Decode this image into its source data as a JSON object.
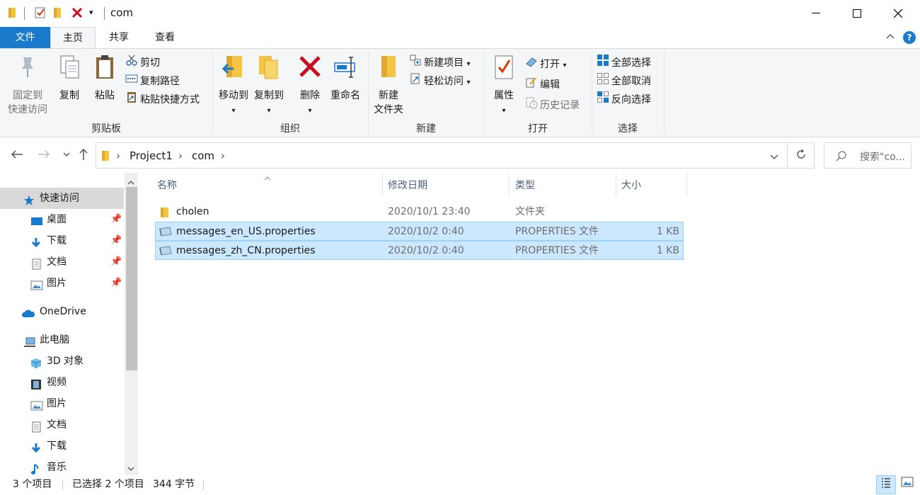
{
  "window": {
    "title": "com",
    "qat_dropdown": "▾",
    "minimize": "—",
    "maximize": "☐",
    "close": "✕",
    "help": "?",
    "collapse": "^"
  },
  "ribbon_tabs": [
    "文件",
    "主页",
    "共享",
    "查看"
  ],
  "ribbon": {
    "clipboard": {
      "label": "剪贴板",
      "pin_line1": "固定到",
      "pin_line2": "快速访问",
      "copy": "复制",
      "paste": "粘贴",
      "cut": "剪切",
      "copy_path": "复制路径",
      "paste_shortcut": "粘贴快捷方式"
    },
    "organize": {
      "label": "组织",
      "move_to": "移动到",
      "copy_to": "复制到",
      "delete": "删除",
      "rename": "重命名"
    },
    "new": {
      "label": "新建",
      "new_folder_line1": "新建",
      "new_folder_line2": "文件夹",
      "new_item": "新建项目",
      "easy_access": "轻松访问"
    },
    "open": {
      "label": "打开",
      "properties": "属性",
      "open": "打开",
      "edit": "编辑",
      "history": "历史记录"
    },
    "select": {
      "label": "选择",
      "select_all": "全部选择",
      "select_none": "全部取消",
      "invert": "反向选择"
    }
  },
  "address": {
    "crumbs": [
      "Project1",
      "com"
    ],
    "search_placeholder": "搜索\"co..."
  },
  "nav": {
    "quick_access": "快速访问",
    "desktop": "桌面",
    "downloads": "下载",
    "documents": "文档",
    "pictures": "图片",
    "onedrive": "OneDrive",
    "this_pc": "此电脑",
    "objects3d": "3D 对象",
    "videos": "视频",
    "pictures2": "图片",
    "documents2": "文档",
    "downloads2": "下载",
    "music": "音乐"
  },
  "columns": {
    "name": "名称",
    "modified": "修改日期",
    "type": "类型",
    "size": "大小"
  },
  "files": [
    {
      "name": "cholen",
      "modified": "2020/10/1 23:40",
      "type": "文件夹",
      "size": "",
      "selected": false
    },
    {
      "name": "messages_en_US.properties",
      "modified": "2020/10/2 0:40",
      "type": "PROPERTIES 文件",
      "size": "1 KB",
      "selected": true
    },
    {
      "name": "messages_zh_CN.properties",
      "modified": "2020/10/2 0:40",
      "type": "PROPERTIES 文件",
      "size": "1 KB",
      "selected": true
    }
  ],
  "status": {
    "count": "3 个项目",
    "selection": "已选择 2 个项目",
    "bytes": "344 字节"
  },
  "colors": {
    "accent": "#1979ca",
    "selection_bg": "#cce8ff",
    "selection_border": "#99d1ff"
  }
}
